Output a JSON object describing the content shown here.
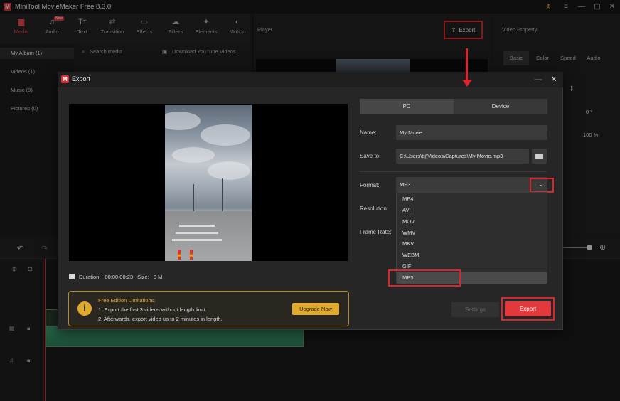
{
  "app": {
    "title": "MiniTool MovieMaker Free 8.3.0"
  },
  "toolbar": {
    "items": [
      {
        "label": "Media",
        "icon": "folder-icon"
      },
      {
        "label": "Audio",
        "icon": "music-note-icon",
        "badge": "New"
      },
      {
        "label": "Text",
        "icon": "text-icon"
      },
      {
        "label": "Transition",
        "icon": "transition-icon"
      },
      {
        "label": "Effects",
        "icon": "effects-icon"
      },
      {
        "label": "Filters",
        "icon": "filters-icon"
      },
      {
        "label": "Elements",
        "icon": "elements-icon"
      },
      {
        "label": "Motion",
        "icon": "motion-icon"
      }
    ]
  },
  "media": {
    "albums": [
      "My Album (1)",
      "Videos (1)",
      "Music (0)",
      "Pictures (0)"
    ],
    "search_placeholder": "Search media",
    "download_label": "Download YouTube Videos"
  },
  "player": {
    "title": "Player",
    "export_label": "Export"
  },
  "property": {
    "title": "Video Property",
    "tabs": [
      "Basic",
      "Color",
      "Speed",
      "Audio"
    ],
    "rotation": "0 °",
    "scale": "100 %"
  },
  "dialog": {
    "title": "Export",
    "tabs": [
      "PC",
      "Device"
    ],
    "name_label": "Name:",
    "name_value": "My Movie",
    "save_label": "Save to:",
    "save_value": "C:\\Users\\bj\\Videos\\Captures\\My Movie.mp3",
    "format_label": "Format:",
    "format_value": "MP3",
    "resolution_label": "Resolution:",
    "framerate_label": "Frame Rate:",
    "format_options": [
      "MP4",
      "AVI",
      "MOV",
      "WMV",
      "MKV",
      "WEBM",
      "GIF",
      "MP3"
    ],
    "selected_format": "MP3",
    "duration_label": "Duration:",
    "duration_value": "00:00:00:23",
    "size_label": "Size:",
    "size_value": "0 M",
    "limits_title": "Free Edition Limitations:",
    "limits_line1": "1. Export the first 3 videos without length limit.",
    "limits_line2": "2. Afterwards, export video up to 2 minutes in length.",
    "upgrade_label": "Upgrade Now",
    "settings_label": "Settings",
    "export_label": "Export"
  },
  "colors": {
    "accent": "#e3393c",
    "highlight": "#d8262c",
    "warning": "#e0aa2e"
  }
}
